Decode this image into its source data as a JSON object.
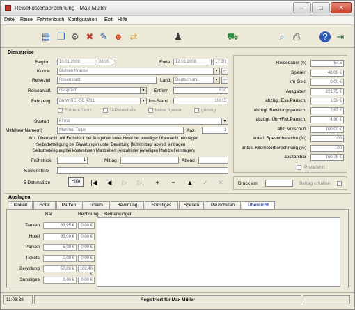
{
  "window": {
    "title": "Reisekostenabrechnung - Max Müller",
    "min": "–",
    "max": "□",
    "close": "✕"
  },
  "menu": [
    "Datei",
    "Reise",
    "Fahrtenbuch",
    "Konfiguration",
    "Exit",
    "Hilfe"
  ],
  "section_title": "Dienstreise",
  "fields": {
    "beginn_label": "Beginn",
    "beginn_date": "10.01.2008",
    "beginn_time": "08:00",
    "ende_label": "Ende",
    "ende_date": "12.01.2008",
    "ende_time": "17:30",
    "kunde_label": "Kunde",
    "kunde": "Blumen Krause",
    "reiseziel_label": "Reiseziel",
    "reiseziel": "Rosenstadt",
    "land_label": "Land",
    "land": "Deutschland",
    "reiseanlass_label": "Reiseanlaß",
    "reiseanlass": "Gespräch",
    "entfern_label": "Entfern",
    "entfern": "530",
    "fahrzeug_label": "Fahrzeug",
    "fahrzeug": "BMW REI-SE 4711",
    "kmstand_label": "km-Stand",
    "kmstand": "10815",
    "firmenfahrz": "Firmen-Fahrz.",
    "ue_pauschale": "Ü-Pauschale",
    "keine_spesen": "keine Spesen",
    "guenstig": "günstig",
    "startort_label": "Startort",
    "startort": "Firma",
    "mitfahrer_label": "Mitfahrer Name(n)",
    "mitfahrer": "Manfred Tulpe",
    "anz_label": "Anz.",
    "anz": "1",
    "note1": "Anz. Übernacht. mit Frühstück bei Ausgaben unter Hotel bei jeweiliger Übernacht. eintragen",
    "note2": "Selbstbeteiligung bei Bewirtungen unter Bewirtung [früh/mittag/ abend] eintragen",
    "note3": "Selbstbeteiligung bei kostenlosen Mahlzeiten (Anzahl der jeweiligen Mahlzeit eintragen)",
    "fruehstueck_label": "Frühstück",
    "fruehstueck": "1",
    "mittag_label": "Mittag",
    "mittag": "",
    "abend_label": "Abend",
    "abend": "",
    "kostenstelle_label": "Kostenstelle",
    "kostenstelle": ""
  },
  "navbar": {
    "count": "5 Datensätze",
    "hilfe": "Hilfe",
    "first": "|◀",
    "prev": "◀",
    "next": "▷",
    "last": "▷|",
    "add": "+",
    "remove": "−",
    "up": "▲",
    "ok": "✓",
    "cancel": "✕"
  },
  "summary": [
    {
      "label": "Reisedauer (h)",
      "value": "57,5"
    },
    {
      "label": "Spesen",
      "value": "48,00 €"
    },
    {
      "label": "km-Geld",
      "value": "0,00 €"
    },
    {
      "label": "Ausgaben",
      "value": "221,75 €"
    },
    {
      "label": "abzügl. Ess.Pausch.",
      "value": "1,50 €"
    },
    {
      "label": "abzügl. Bewitungspausch.",
      "value": "2,67 €"
    },
    {
      "label": "abzügl. Üb.+Fist.Pausch.",
      "value": "4,80 €"
    },
    {
      "label": "abz. Vorschuß",
      "value": "100,00 €"
    },
    {
      "label": "anteil. Spesenberechn.(%)",
      "value": "100"
    },
    {
      "label": "anteil. Kilometerberechnung (%)",
      "value": "100"
    },
    {
      "label": "auszahlbar",
      "value": "160,78 €"
    }
  ],
  "privatfahrt": "Privatfahrt",
  "druck_am": "Druck am",
  "druck_am_value": "",
  "betrag_erhalten": "Betrag erhalten",
  "auslagen_title": "Auslagen",
  "tabs": [
    "Tanken",
    "Hotel",
    "Parken",
    "Tickets",
    "Bewirtung",
    "Sonstiges",
    "Spesen",
    "Pauschalen",
    "Übersicht"
  ],
  "grid": {
    "col_bar": "Bar",
    "col_rechnung": "Rechnung",
    "col_bemerkungen": "Bemerkungen",
    "rows": [
      {
        "label": "Tanken",
        "bar": "63,95 €",
        "rechnung": "0,00 €"
      },
      {
        "label": "Hotel",
        "bar": "85,00 €",
        "rechnung": "0,00 €"
      },
      {
        "label": "Parken",
        "bar": "5,00 €",
        "rechnung": "0,00 €"
      },
      {
        "label": "Tickets",
        "bar": "0,00 €",
        "rechnung": "0,00 €"
      },
      {
        "label": "Bewirtung",
        "bar": "67,80 €",
        "rechnung": "102,40 €"
      },
      {
        "label": "Sonstiges",
        "bar": "0,00 €",
        "rechnung": "0,00 €"
      }
    ]
  },
  "status": {
    "time": "11:08:38",
    "registered": "Registriert für Max Müller"
  },
  "colors": {
    "dialog_bg": "#ece9d8",
    "title_bg": "#f0f0f0",
    "window_border": "#8a8a8a"
  },
  "icons": [
    "new-doc-icon",
    "copy-doc-icon",
    "settings-icon",
    "delete-icon",
    "edit-icon",
    "user-icon",
    "transfer-icon",
    "spy-icon",
    "car-icon",
    "search-icon",
    "print-icon",
    "help-icon",
    "exit-icon"
  ]
}
